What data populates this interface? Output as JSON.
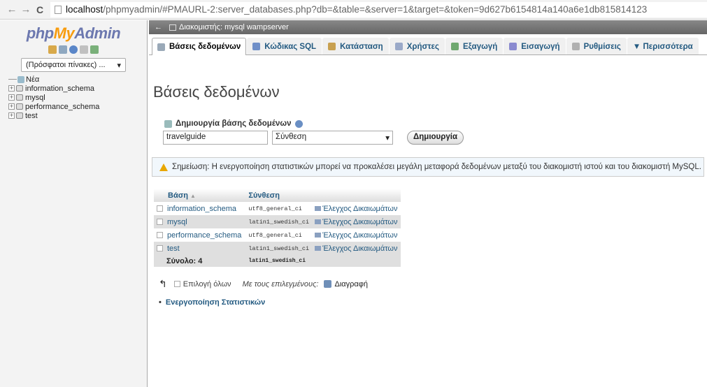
{
  "browser": {
    "back": "←",
    "forward": "→",
    "reload": "C",
    "url_host": "localhost",
    "url_rest": "/phpmyadmin/#PMAURL-2:server_databases.php?db=&table=&server=1&target=&token=9d627b6154814a140a6e1db815814123"
  },
  "sidebar": {
    "logo": {
      "php": "php",
      "my": "My",
      "admin": "Admin"
    },
    "recent_select": "(Πρόσφατοι πίνακες) ...",
    "tree": [
      {
        "label": "Νέα",
        "kind": "new"
      },
      {
        "label": "information_schema",
        "kind": "db"
      },
      {
        "label": "mysql",
        "kind": "db"
      },
      {
        "label": "performance_schema",
        "kind": "db"
      },
      {
        "label": "test",
        "kind": "db"
      }
    ]
  },
  "server_bar": {
    "label": "Διακομιστής: mysql wampserver"
  },
  "tabs": [
    {
      "label": "Βάσεις δεδομένων",
      "icon": "database-icon",
      "color": "#9aa9b8",
      "active": true
    },
    {
      "label": "Κώδικας SQL",
      "icon": "sql-icon",
      "color": "#6f8fc8",
      "active": false
    },
    {
      "label": "Κατάσταση",
      "icon": "status-icon",
      "color": "#c8a050",
      "active": false
    },
    {
      "label": "Χρήστες",
      "icon": "users-icon",
      "color": "#9aa9c8",
      "active": false
    },
    {
      "label": "Εξαγωγή",
      "icon": "export-icon",
      "color": "#6fa86f",
      "active": false
    },
    {
      "label": "Εισαγωγή",
      "icon": "import-icon",
      "color": "#8a8ad0",
      "active": false
    },
    {
      "label": "Ρυθμίσεις",
      "icon": "settings-icon",
      "color": "#b0b0b0",
      "active": false
    },
    {
      "label": "▼ Περισσότερα",
      "icon": "",
      "color": "",
      "active": false
    }
  ],
  "main": {
    "title": "Βάσεις δεδομένων",
    "create_label": "Δημιουργία βάσης δεδομένων",
    "db_name_value": "travelguide",
    "collation_select": "Σύνθεση",
    "create_button": "Δημιουργία",
    "notice": "Σημείωση: Η ενεργοποίηση στατιστικών μπορεί να προκαλέσει μεγάλη μεταφορά δεδομένων μεταξύ του διακομιστή ιστού και του διακομιστή MySQL."
  },
  "table": {
    "headers": {
      "name": "Βάση",
      "sort": "▲",
      "collation": "Σύνθεση"
    },
    "rows": [
      {
        "name": "information_schema",
        "collation": "utf8_general_ci",
        "action": "Έλεγχος Δικαιωμάτων"
      },
      {
        "name": "mysql",
        "collation": "latin1_swedish_ci",
        "action": "Έλεγχος Δικαιωμάτων"
      },
      {
        "name": "performance_schema",
        "collation": "utf8_general_ci",
        "action": "Έλεγχος Δικαιωμάτων"
      },
      {
        "name": "test",
        "collation": "latin1_swedish_ci",
        "action": "Έλεγχος Δικαιωμάτων"
      }
    ],
    "total_label": "Σύνολο: 4",
    "total_collation": "latin1_swedish_ci"
  },
  "bottom": {
    "select_all": "Επιλογή όλων",
    "with_selected": "Με τους επιλεγμένους:",
    "delete": "Διαγραφή",
    "enable_stats": "Ενεργοποίηση Στατιστικών",
    "bullet": "•"
  }
}
